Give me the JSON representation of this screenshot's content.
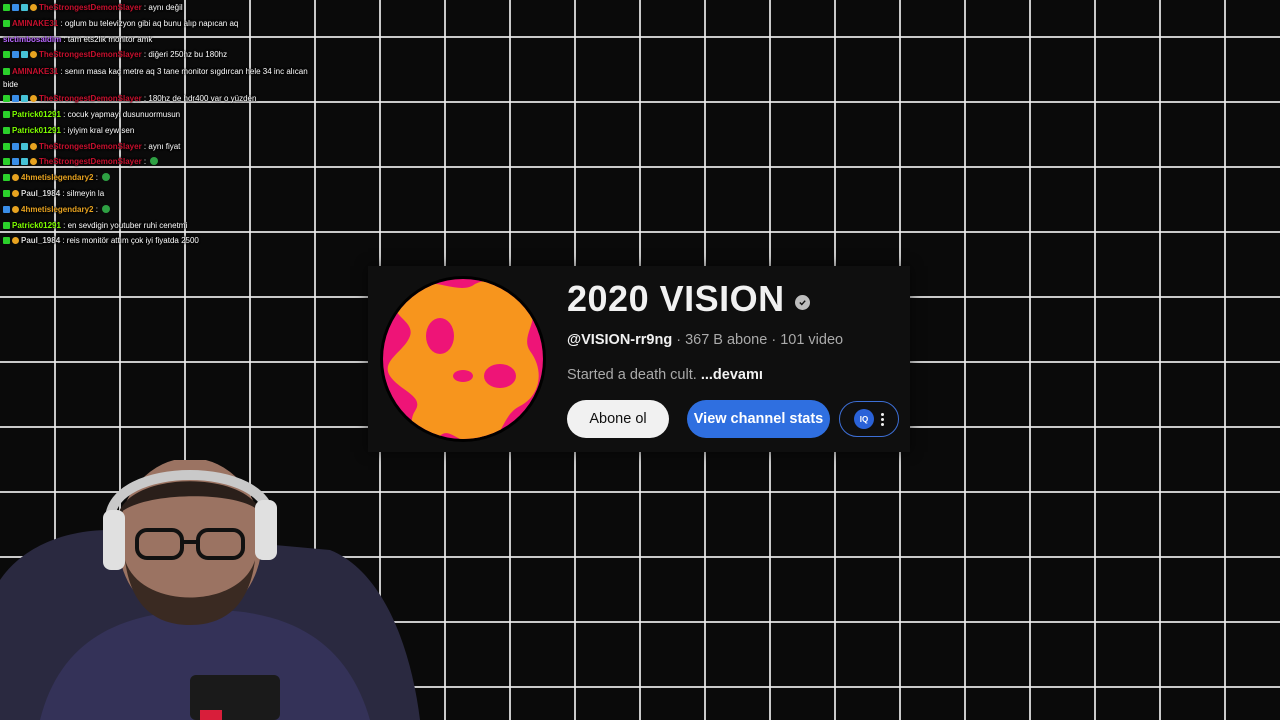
{
  "chat": {
    "messages": [
      {
        "user": "TheStrongestDemonSlayer",
        "user_color": "#c8102e",
        "text": ": aynı değil",
        "badges": [
          "green",
          "blue",
          "cyan",
          "orange"
        ]
      },
      {
        "user": "AMINAKE31",
        "user_color": "#c8102e",
        "text": ": oglum bu televizyon gibi aq bunu alıp napıcan aq",
        "badges": [
          "green"
        ]
      },
      {
        "user": "sictimbosaldim",
        "user_color": "#b967ff",
        "text": ": tam ets2lik monitor amk",
        "badges": []
      },
      {
        "user": "TheStrongestDemonSlayer",
        "user_color": "#c8102e",
        "text": ": diğeri 250hz bu 180hz",
        "badges": [
          "green",
          "blue",
          "cyan",
          "orange"
        ]
      },
      {
        "user": "AMINAKE31",
        "user_color": "#c8102e",
        "text": ": senın masa kaç metre aq 3 tane monitor sıgdırcan hele 34 inc alıcan bide",
        "badges": [
          "green"
        ]
      },
      {
        "user": "TheStrongestDemonSlayer",
        "user_color": "#c8102e",
        "text": ": 180hz de hdr400 var o yüzden",
        "badges": [
          "green",
          "blue",
          "cyan",
          "orange"
        ]
      },
      {
        "user": "Patrick01291",
        "user_color": "#7fff00",
        "text": ": cocuk yapmayi dusunuormusun",
        "badges": [
          "green"
        ]
      },
      {
        "user": "Patrick01291",
        "user_color": "#7fff00",
        "text": ": iyiyim kral eyw sen",
        "badges": [
          "green"
        ]
      },
      {
        "user": "TheStrongestDemonSlayer",
        "user_color": "#c8102e",
        "text": ": aynı fiyat",
        "badges": [
          "green",
          "blue",
          "cyan",
          "orange"
        ]
      },
      {
        "user": "TheStrongestDemonSlayer",
        "user_color": "#c8102e",
        "text": ":",
        "badges": [
          "green",
          "blue",
          "cyan",
          "orange"
        ],
        "emote": true
      },
      {
        "user": "4hmetislegendary2",
        "user_color": "#e8a320",
        "text": ":",
        "badges": [
          "green",
          "orange"
        ],
        "emote": true
      },
      {
        "user": "Paul_1984",
        "user_color": "#d6d6d6",
        "text": ": silmeyin la",
        "badges": [
          "green",
          "orange"
        ]
      },
      {
        "user": "4hmetislegendary2",
        "user_color": "#e8a320",
        "text": ":",
        "badges": [
          "blue",
          "orange"
        ],
        "emote": true
      },
      {
        "user": "Patrick01291",
        "user_color": "#7fff00",
        "text": ": en sevdigin youtuber ruhi cenetmi",
        "badges": [
          "green"
        ]
      },
      {
        "user": "Paul_1984",
        "user_color": "#d6d6d6",
        "text": ": reis monitör attım çok iyi fiyatda 2500",
        "badges": [
          "green",
          "orange"
        ]
      }
    ]
  },
  "channel": {
    "title": "2020 VISION",
    "handle": "@VISION-rr9ng",
    "stats": " · 367 B abone · 101 video",
    "description": "Started a death cult. ",
    "more_label": "...devamı",
    "subscribe_label": "Abone ol",
    "stats_button_label": "View channel stats",
    "ext_logo_text": "IQ",
    "colors": {
      "avatar_pink": "#ee1477",
      "avatar_orange": "#f7951d",
      "stats_button": "#2f6fe0"
    }
  }
}
